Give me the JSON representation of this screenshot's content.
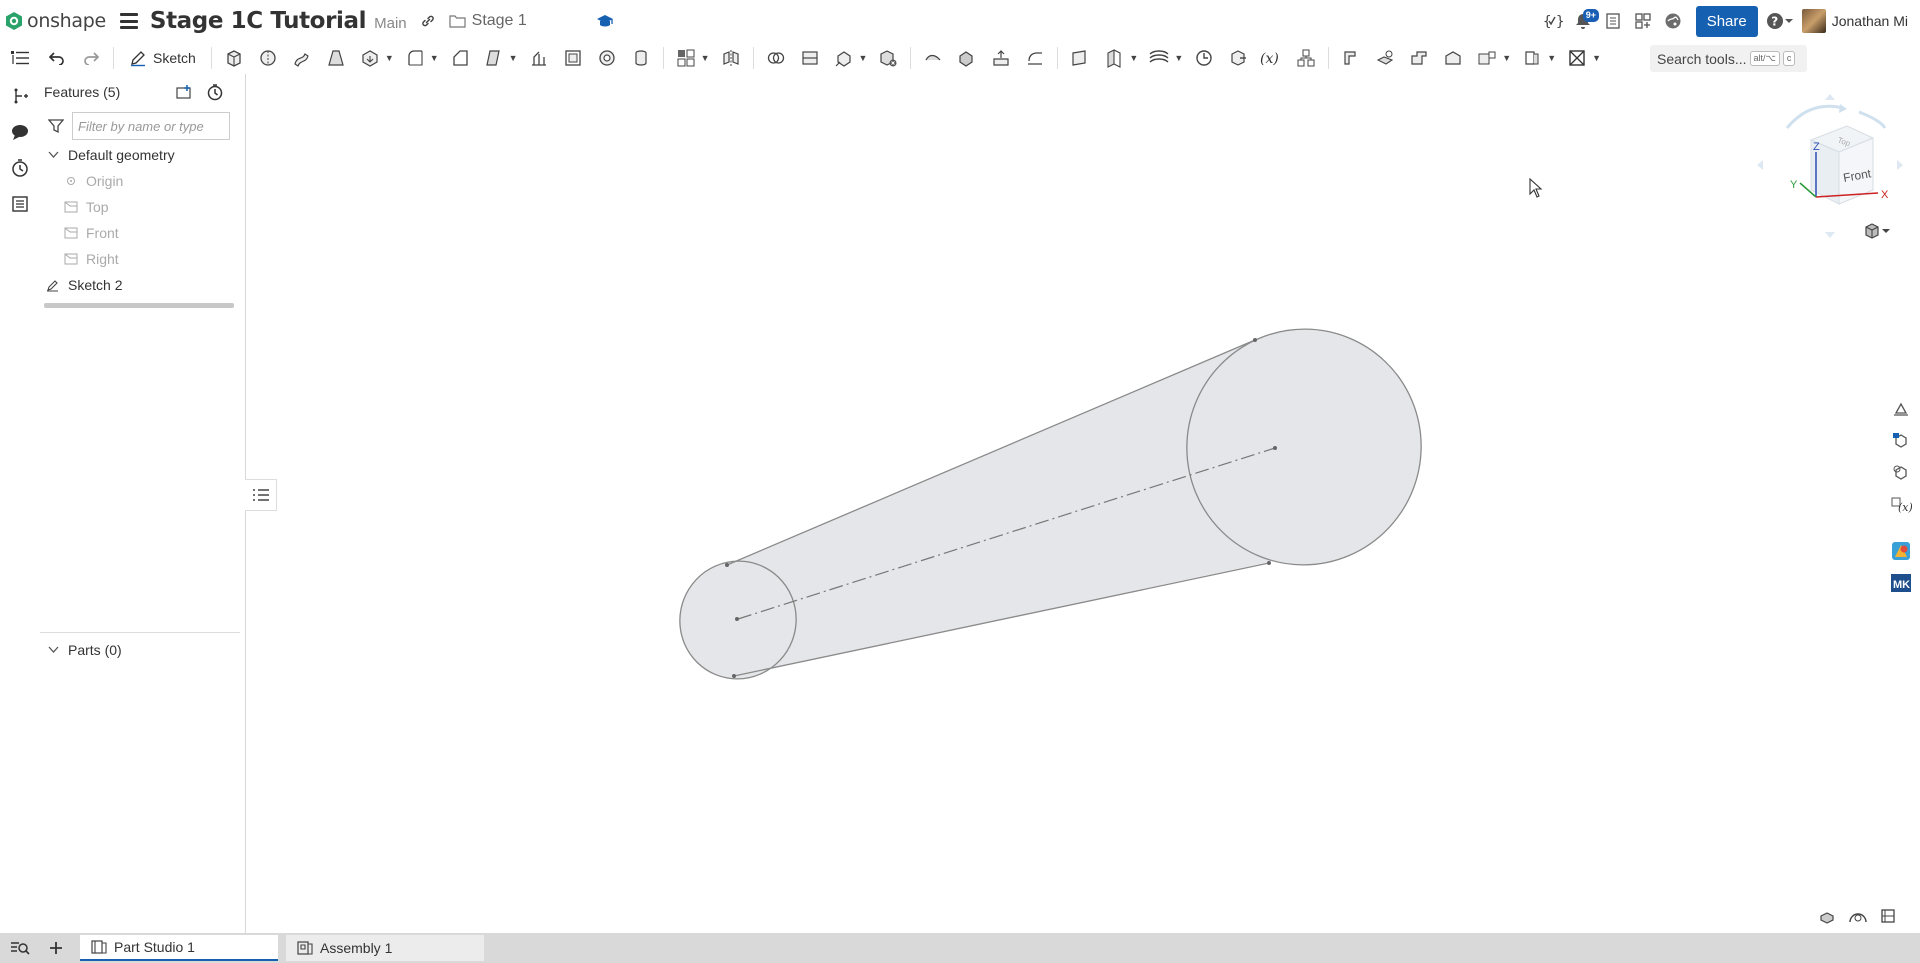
{
  "app": {
    "logo_text": "onshape",
    "doc_title": "Stage 1C Tutorial",
    "branch": "Main",
    "folder": "Stage 1"
  },
  "topbar": {
    "notification_count": "9+",
    "share_label": "Share",
    "user_name": "Jonathan Mi"
  },
  "toolbar": {
    "sketch_label": "Sketch",
    "search_label": "Search tools...",
    "search_shortcut_1": "alt/⌥",
    "search_shortcut_2": "c"
  },
  "feature_panel": {
    "title": "Features (5)",
    "filter_placeholder": "Filter by name or type",
    "groups": [
      {
        "label": "Default geometry",
        "children": [
          "Origin",
          "Top",
          "Front",
          "Right"
        ]
      }
    ],
    "features": [
      "Sketch 2"
    ],
    "parts_label": "Parts (0)"
  },
  "view_cube": {
    "front_label": "Front",
    "top_label": "Top",
    "axis_x": "X",
    "axis_y": "Y",
    "axis_z": "Z"
  },
  "tabs": [
    {
      "label": "Part Studio 1",
      "active": true
    },
    {
      "label": "Assembly 1",
      "active": false
    }
  ],
  "colors": {
    "accent": "#1660b2",
    "model_fill": "#e4e6e9",
    "model_edge": "#8a8a8a"
  }
}
